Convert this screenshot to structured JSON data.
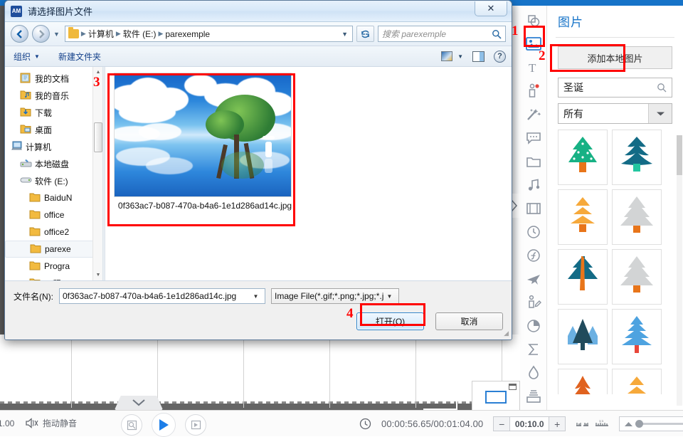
{
  "app": {
    "accent": "#1673c8",
    "stage_bg": "#5a5a5a",
    "help_badge": "?:?"
  },
  "player_bar": {
    "rate": "1.00",
    "mute_icon": "speaker-mute-icon",
    "mute_label": "拖动静音",
    "snapshot_icon": "snapshot-icon",
    "play_icon": "play-icon",
    "frame_step_icon": "frame-step-icon",
    "clock_icon": "clock-icon",
    "time_display": "00:00:56.65/00:01:04.00",
    "stepper": {
      "minus": "−",
      "value": "00:10.0",
      "plus": "+"
    },
    "marker_icons": [
      "timeline-marks-icon",
      "timeline-ruler-icon"
    ],
    "zoom_slider": {
      "min_icon": "zoom-out-icon",
      "max_icon": "zoom-in-icon",
      "value_pct": 6
    }
  },
  "right_panel": {
    "title": "图片",
    "add_button": "添加本地图片",
    "search_value": "圣诞",
    "search_icon": "search-icon",
    "filter_value": "所有",
    "rail_icons": [
      "shapes-icon",
      "image-icon",
      "text-icon",
      "character-icon",
      "effects-icon",
      "callout-icon",
      "folder-icon",
      "music-icon",
      "video-icon",
      "clock-icon",
      "function-icon",
      "airplane-icon",
      "person-edit-icon",
      "pie-chart-icon",
      "sigma-icon",
      "water-drop-icon",
      "archive-icon",
      "add-image-icon"
    ],
    "rail_active_index": 1,
    "assets": [
      {
        "name": "tree-dotted-green",
        "style": "dotted",
        "body": "#17b184",
        "trunk": "#e8751a"
      },
      {
        "name": "tree-layered-teal",
        "style": "wavy",
        "body": "#136b86",
        "trunk": "#23c6a0"
      },
      {
        "name": "tree-stacked-orange",
        "style": "stacked",
        "body": "#f6a93b",
        "trunk": "#e8751a"
      },
      {
        "name": "tree-solid-grey",
        "style": "jagged",
        "body": "#d2d4d5",
        "trunk": "#e8751a"
      },
      {
        "name": "tree-split-teal",
        "style": "split",
        "body": "#136b86",
        "trunk": "#e8751a"
      },
      {
        "name": "tree-jagged-grey",
        "style": "jagged",
        "body": "#d2d4d5",
        "trunk": "#e8751a"
      },
      {
        "name": "tree-group-blue",
        "style": "group",
        "body": "#214b5c",
        "trunk": "#6bb0e2"
      },
      {
        "name": "tree-layered-blue",
        "style": "layered",
        "body": "#4ea3e0",
        "trunk": "#e8463a"
      },
      {
        "name": "tree-flame-orange",
        "style": "flame",
        "body": "#e0621f",
        "trunk": "#e0621f"
      },
      {
        "name": "tree-stacked-amber",
        "style": "stacked",
        "body": "#f6a93b",
        "trunk": "#e8751a"
      }
    ]
  },
  "dialog": {
    "app_icon_text": "AM",
    "title": "请选择图片文件",
    "close_label": "✕",
    "nav": {
      "back_icon": "back-arrow-icon",
      "forward_icon": "forward-arrow-icon",
      "history_icon": "chevron-down-icon",
      "refresh_icon": "refresh-icon",
      "breadcrumbs": [
        "计算机",
        "软件 (E:)",
        "parexemple"
      ],
      "breadcrumb_arrow": "▼",
      "search_placeholder": "搜索 parexemple",
      "search_icon": "search-icon"
    },
    "toolbar": {
      "organize": "组织",
      "organize_caret": "▼",
      "new_folder": "新建文件夹",
      "view_icon": "view-mode-icon",
      "view_caret": "▼",
      "pane_icon": "preview-pane-icon",
      "help_icon": "help-icon"
    },
    "tree": [
      {
        "label": "我的文档",
        "icon": "documents-icon",
        "indent": 1,
        "selected": false
      },
      {
        "label": "我的音乐",
        "icon": "music-folder-icon",
        "indent": 1,
        "selected": false
      },
      {
        "label": "下载",
        "icon": "downloads-icon",
        "indent": 1,
        "selected": false
      },
      {
        "label": "桌面",
        "icon": "desktop-icon",
        "indent": 1,
        "selected": false
      },
      {
        "label": "计算机",
        "icon": "computer-icon",
        "indent": 0,
        "selected": false
      },
      {
        "label": "本地磁盘",
        "icon": "harddisk-icon",
        "indent": 1,
        "selected": false
      },
      {
        "label": "软件 (E:)",
        "icon": "drive-icon",
        "indent": 1,
        "selected": false
      },
      {
        "label": "BaiduN",
        "icon": "folder-icon",
        "indent": 2,
        "selected": false
      },
      {
        "label": "office",
        "icon": "folder-icon",
        "indent": 2,
        "selected": false
      },
      {
        "label": "office2",
        "icon": "folder-icon",
        "indent": 2,
        "selected": false
      },
      {
        "label": "parexe",
        "icon": "folder-icon",
        "indent": 2,
        "selected": true
      },
      {
        "label": "Progra",
        "icon": "folder-icon",
        "indent": 2,
        "selected": false
      },
      {
        "label": "工程",
        "icon": "folder-icon",
        "indent": 2,
        "selected": false
      }
    ],
    "file": {
      "thumb_name": "cloud-tree-reflection-image",
      "label": "0f363ac7-b087-470a-b4a6-1e1d286ad14c.jpg"
    },
    "bottom": {
      "filename_label": "文件名(N):",
      "filename_value": "0f363ac7-b087-470a-b4a6-1e1d286ad14c.jpg",
      "filetype_value": "Image File(*.gif;*.png;*.jpg;*.j",
      "open_button": "打开(O)",
      "cancel_button": "取消"
    }
  },
  "annotations": [
    {
      "num": "1",
      "target": "image-rail-icon"
    },
    {
      "num": "2",
      "target": "add-local-image-button"
    },
    {
      "num": "3",
      "target": "file-thumbnail-item"
    },
    {
      "num": "4",
      "target": "open-button"
    }
  ]
}
